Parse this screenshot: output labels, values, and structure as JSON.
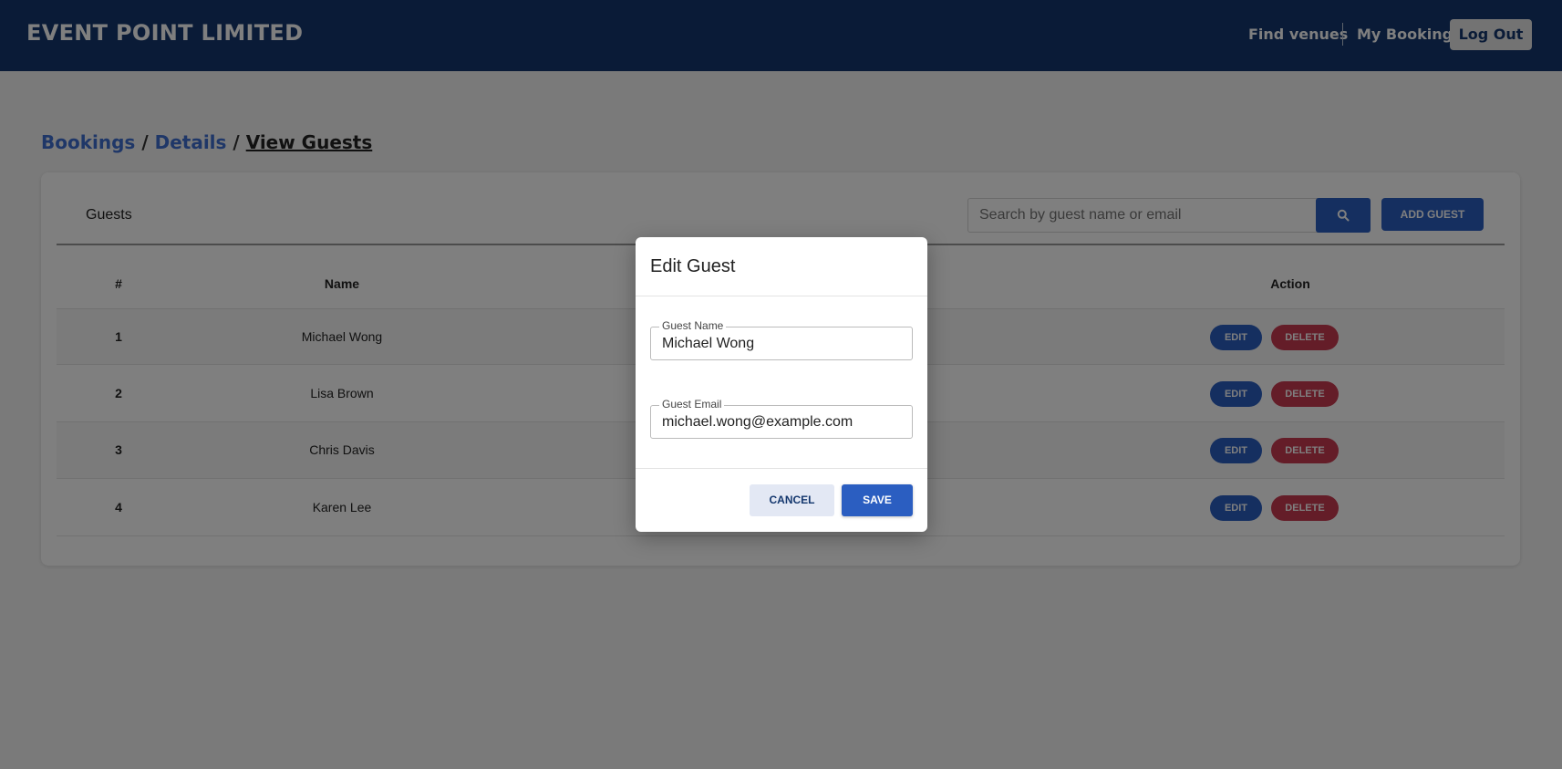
{
  "header": {
    "brand": "EVENT POINT LIMITED",
    "nav": {
      "find_venues": "Find venues",
      "my_booking": "My Booking",
      "logout": "Log Out"
    }
  },
  "breadcrumb": {
    "bookings": "Bookings",
    "details": "Details",
    "current": "View Guests",
    "separator": "/"
  },
  "guests_card": {
    "title": "Guests",
    "search_placeholder": "Search by guest name or email",
    "search_icon": "search-icon",
    "add_label": "ADD GUEST",
    "columns": {
      "num": "#",
      "name": "Name",
      "action": "Action"
    },
    "rows": [
      {
        "num": "1",
        "name": "Michael Wong"
      },
      {
        "num": "2",
        "name": "Lisa Brown"
      },
      {
        "num": "3",
        "name": "Chris Davis"
      },
      {
        "num": "4",
        "name": "Karen Lee"
      }
    ],
    "edit_label": "EDIT",
    "delete_label": "DELETE"
  },
  "modal": {
    "title": "Edit Guest",
    "name_label": "Guest Name",
    "name_value": "Michael Wong",
    "email_label": "Guest Email",
    "email_value": "michael.wong@example.com",
    "cancel_label": "CANCEL",
    "save_label": "SAVE"
  },
  "colors": {
    "header_bg": "#14376e",
    "primary": "#2b5ec1",
    "danger": "#c93a50",
    "link": "#3f6fd0"
  }
}
